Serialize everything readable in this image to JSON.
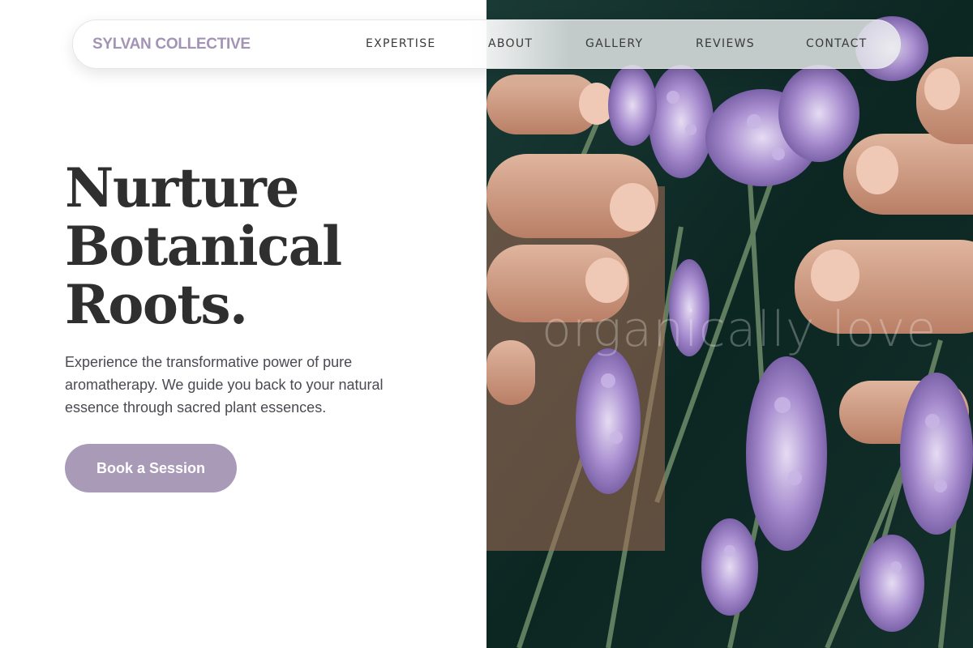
{
  "nav": {
    "brand": "SYLVAN COLLECTIVE",
    "links": [
      "EXPERTISE",
      "ABOUT",
      "GALLERY",
      "REVIEWS",
      "CONTACT"
    ]
  },
  "hero": {
    "title_lines": [
      "Nurture",
      "Botanical",
      "Roots."
    ],
    "description": "Experience the transformative power of pure aromatherapy. We guide you back to your natural essence through sacred plant essences.",
    "cta_label": "Book a Session"
  },
  "image": {
    "overlay_text": "organically love",
    "subject": "hands among lavender flowers"
  },
  "colors": {
    "accent": "#a99ab8",
    "brand": "#a394b6",
    "heading": "#2f2f2f",
    "body_text": "#4a4a52",
    "photo_dark": "#0f2a26",
    "lavender": "#a98fd0"
  }
}
